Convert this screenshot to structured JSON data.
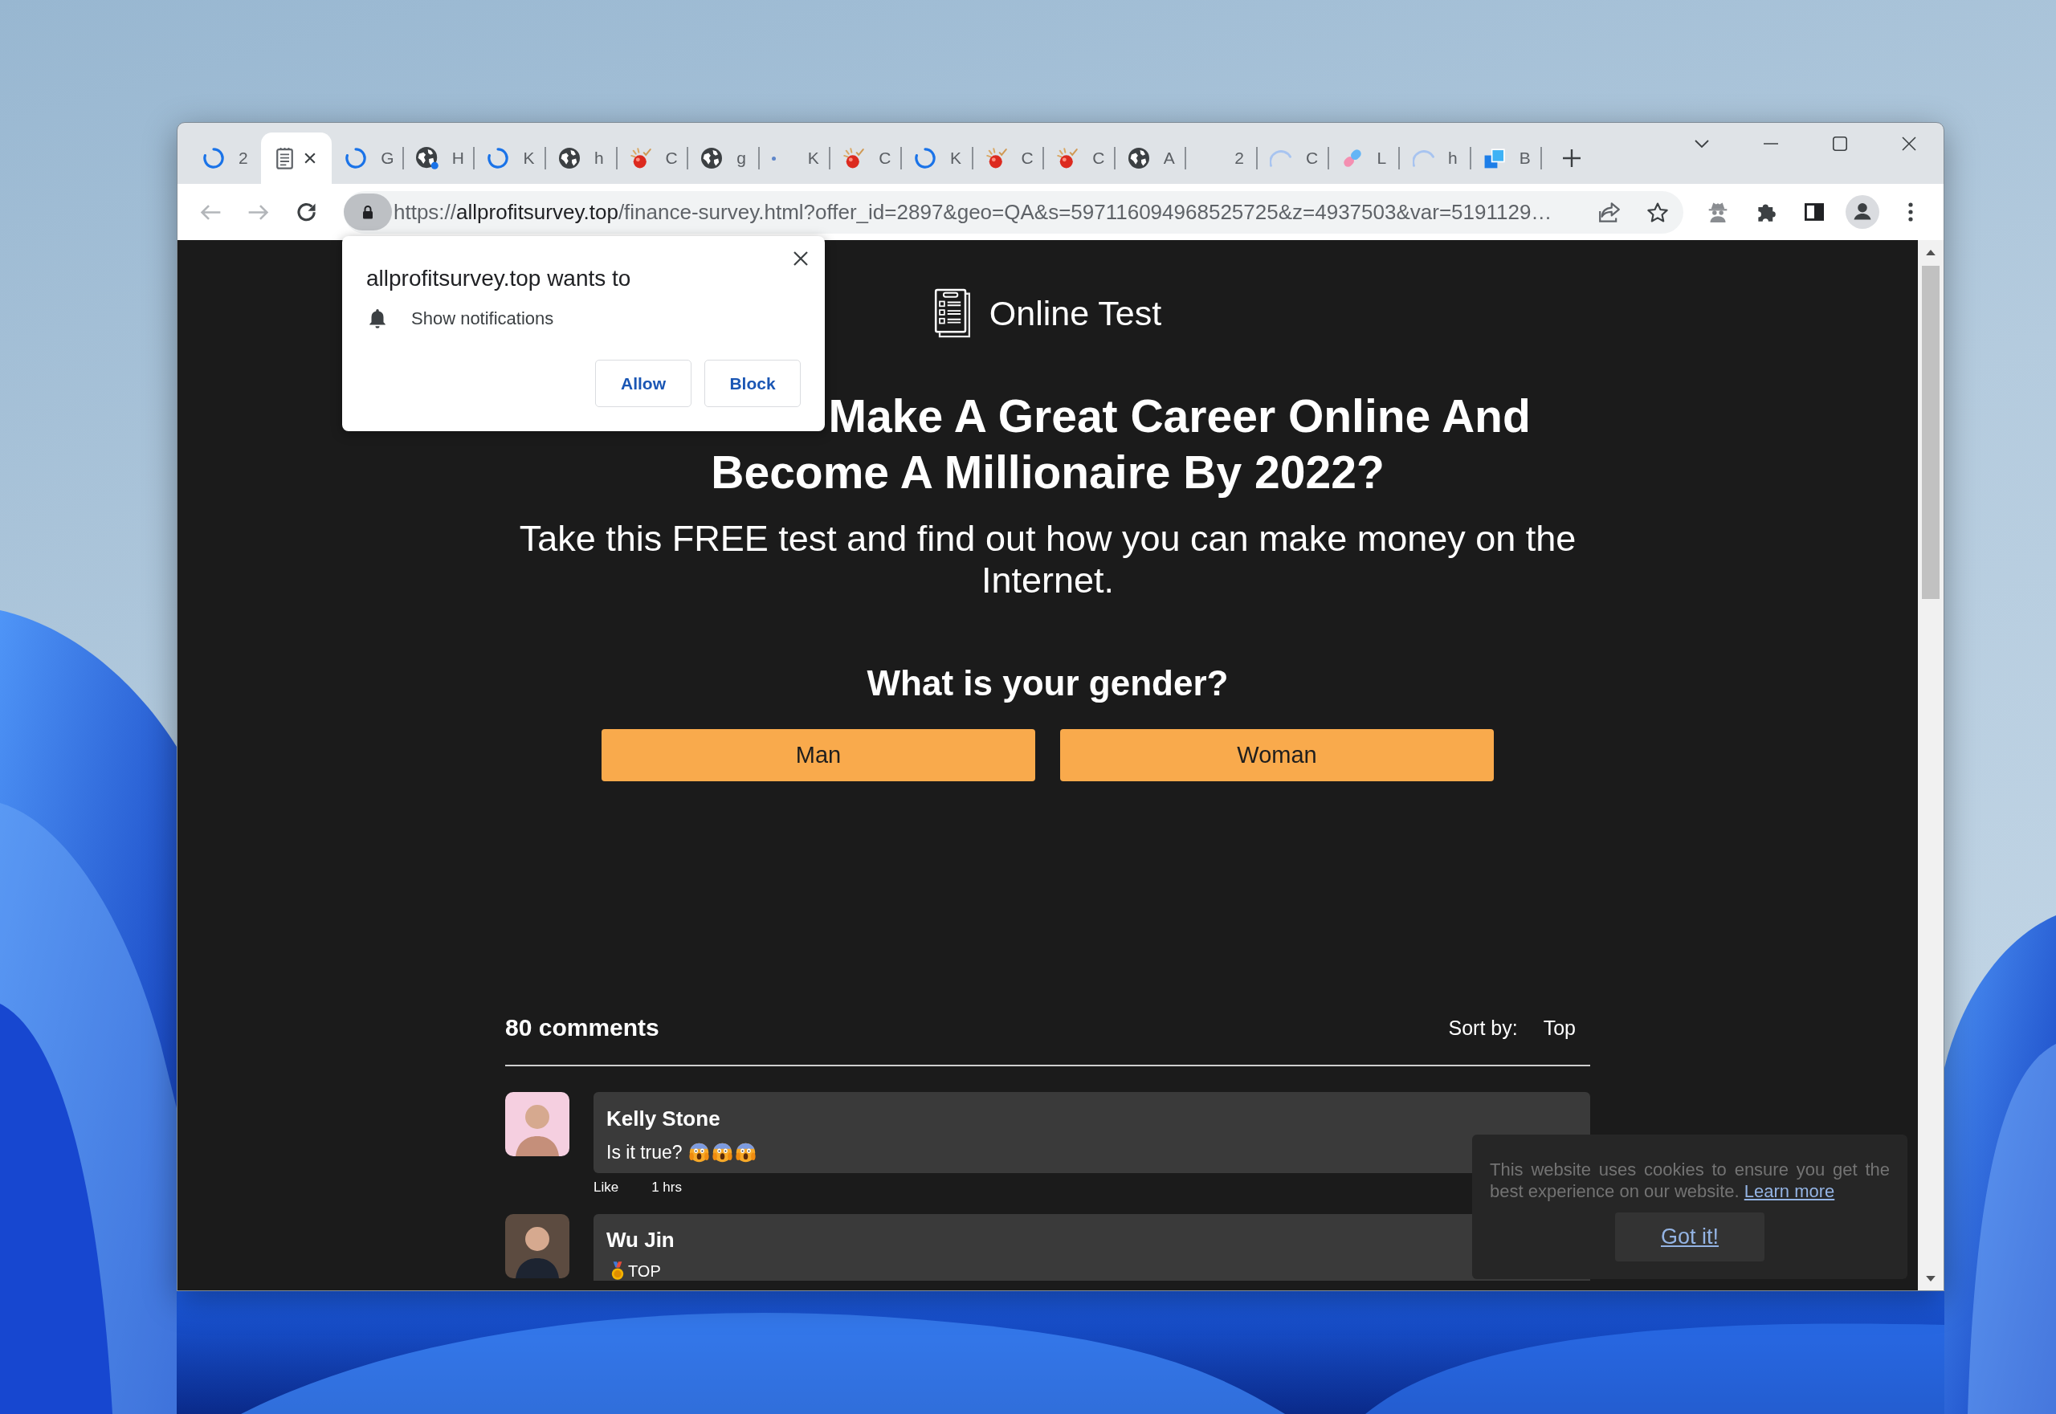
{
  "browser": {
    "tabs": [
      {
        "kind": "loading",
        "title": "2",
        "selected": false,
        "attention": false
      },
      {
        "kind": "page",
        "selected": true,
        "attention": false
      },
      {
        "kind": "loading",
        "title": "G",
        "selected": false,
        "attention": false
      },
      {
        "kind": "globe",
        "title": "H",
        "selected": false,
        "attention": true
      },
      {
        "kind": "loading",
        "title": "K",
        "selected": false,
        "attention": false
      },
      {
        "kind": "globe",
        "title": "h",
        "selected": false,
        "attention": false
      },
      {
        "kind": "ball",
        "title": "C",
        "selected": false,
        "attention": false
      },
      {
        "kind": "globe",
        "title": "g",
        "selected": false,
        "attention": false
      },
      {
        "kind": "dot",
        "title": "K",
        "selected": false,
        "attention": false
      },
      {
        "kind": "ball",
        "title": "C",
        "selected": false,
        "attention": false
      },
      {
        "kind": "loading",
        "title": "K",
        "selected": false,
        "attention": false
      },
      {
        "kind": "ball",
        "title": "C",
        "selected": false,
        "attention": false
      },
      {
        "kind": "ball",
        "title": "C",
        "selected": false,
        "attention": false
      },
      {
        "kind": "globe",
        "title": "A",
        "selected": false,
        "attention": false
      },
      {
        "kind": "blank",
        "title": "2",
        "selected": false,
        "attention": false
      },
      {
        "kind": "waiting",
        "title": "C",
        "selected": false,
        "attention": false
      },
      {
        "kind": "capsule",
        "title": "L",
        "selected": false,
        "attention": false
      },
      {
        "kind": "waiting",
        "title": "h",
        "selected": false,
        "attention": false
      },
      {
        "kind": "squares",
        "title": "B",
        "selected": false,
        "attention": false
      }
    ],
    "navigation": {
      "back": {
        "disabled": true
      },
      "forward": {
        "disabled": true
      }
    },
    "address_bar": {
      "scheme": "https://",
      "host": "allprofitsurvey.top",
      "path": "/finance-survey.html?offer_id=2897&geo=QA&s=597116094968525725&z=4937503&var=5191129…"
    },
    "permission_prompt": {
      "title": "allprofitsurvey.top wants to",
      "permission": "Show notifications",
      "buttons": [
        "Allow",
        "Block"
      ]
    }
  },
  "page": {
    "logo": "Online Test",
    "headline": [
      "Make A Great Career Online And",
      "Become A Millionaire By 2022?"
    ],
    "intro": "Take this FREE test and find out how you can make money on the Internet.",
    "question": "What is your gender?",
    "answers": [
      "Man",
      "Woman"
    ],
    "comments": {
      "count": "80 comments",
      "sort_label": "Sort by:",
      "sort_value": "Top",
      "items": [
        {
          "name": "Kelly Stone",
          "text": "Is it true?",
          "emoji": [
            {
              "kind": "scream"
            },
            {
              "kind": "scream"
            },
            {
              "kind": "scream"
            }
          ],
          "like": "Like",
          "time": "1 hrs"
        },
        {
          "name": "Wu Jin",
          "badge": "TOP"
        }
      ]
    },
    "cookie_banner": {
      "text": "This website uses cookies to ensure you get the best experience on our website.",
      "link": "Learn more",
      "button": "Got it!"
    }
  }
}
